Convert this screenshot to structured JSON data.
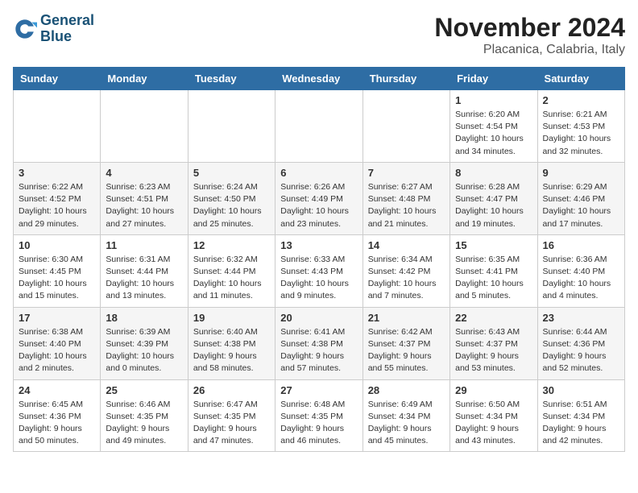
{
  "logo": {
    "line1": "General",
    "line2": "Blue"
  },
  "title": "November 2024",
  "location": "Placanica, Calabria, Italy",
  "headers": [
    "Sunday",
    "Monday",
    "Tuesday",
    "Wednesday",
    "Thursday",
    "Friday",
    "Saturday"
  ],
  "weeks": [
    [
      {
        "day": "",
        "info": ""
      },
      {
        "day": "",
        "info": ""
      },
      {
        "day": "",
        "info": ""
      },
      {
        "day": "",
        "info": ""
      },
      {
        "day": "",
        "info": ""
      },
      {
        "day": "1",
        "info": "Sunrise: 6:20 AM\nSunset: 4:54 PM\nDaylight: 10 hours and 34 minutes."
      },
      {
        "day": "2",
        "info": "Sunrise: 6:21 AM\nSunset: 4:53 PM\nDaylight: 10 hours and 32 minutes."
      }
    ],
    [
      {
        "day": "3",
        "info": "Sunrise: 6:22 AM\nSunset: 4:52 PM\nDaylight: 10 hours and 29 minutes."
      },
      {
        "day": "4",
        "info": "Sunrise: 6:23 AM\nSunset: 4:51 PM\nDaylight: 10 hours and 27 minutes."
      },
      {
        "day": "5",
        "info": "Sunrise: 6:24 AM\nSunset: 4:50 PM\nDaylight: 10 hours and 25 minutes."
      },
      {
        "day": "6",
        "info": "Sunrise: 6:26 AM\nSunset: 4:49 PM\nDaylight: 10 hours and 23 minutes."
      },
      {
        "day": "7",
        "info": "Sunrise: 6:27 AM\nSunset: 4:48 PM\nDaylight: 10 hours and 21 minutes."
      },
      {
        "day": "8",
        "info": "Sunrise: 6:28 AM\nSunset: 4:47 PM\nDaylight: 10 hours and 19 minutes."
      },
      {
        "day": "9",
        "info": "Sunrise: 6:29 AM\nSunset: 4:46 PM\nDaylight: 10 hours and 17 minutes."
      }
    ],
    [
      {
        "day": "10",
        "info": "Sunrise: 6:30 AM\nSunset: 4:45 PM\nDaylight: 10 hours and 15 minutes."
      },
      {
        "day": "11",
        "info": "Sunrise: 6:31 AM\nSunset: 4:44 PM\nDaylight: 10 hours and 13 minutes."
      },
      {
        "day": "12",
        "info": "Sunrise: 6:32 AM\nSunset: 4:44 PM\nDaylight: 10 hours and 11 minutes."
      },
      {
        "day": "13",
        "info": "Sunrise: 6:33 AM\nSunset: 4:43 PM\nDaylight: 10 hours and 9 minutes."
      },
      {
        "day": "14",
        "info": "Sunrise: 6:34 AM\nSunset: 4:42 PM\nDaylight: 10 hours and 7 minutes."
      },
      {
        "day": "15",
        "info": "Sunrise: 6:35 AM\nSunset: 4:41 PM\nDaylight: 10 hours and 5 minutes."
      },
      {
        "day": "16",
        "info": "Sunrise: 6:36 AM\nSunset: 4:40 PM\nDaylight: 10 hours and 4 minutes."
      }
    ],
    [
      {
        "day": "17",
        "info": "Sunrise: 6:38 AM\nSunset: 4:40 PM\nDaylight: 10 hours and 2 minutes."
      },
      {
        "day": "18",
        "info": "Sunrise: 6:39 AM\nSunset: 4:39 PM\nDaylight: 10 hours and 0 minutes."
      },
      {
        "day": "19",
        "info": "Sunrise: 6:40 AM\nSunset: 4:38 PM\nDaylight: 9 hours and 58 minutes."
      },
      {
        "day": "20",
        "info": "Sunrise: 6:41 AM\nSunset: 4:38 PM\nDaylight: 9 hours and 57 minutes."
      },
      {
        "day": "21",
        "info": "Sunrise: 6:42 AM\nSunset: 4:37 PM\nDaylight: 9 hours and 55 minutes."
      },
      {
        "day": "22",
        "info": "Sunrise: 6:43 AM\nSunset: 4:37 PM\nDaylight: 9 hours and 53 minutes."
      },
      {
        "day": "23",
        "info": "Sunrise: 6:44 AM\nSunset: 4:36 PM\nDaylight: 9 hours and 52 minutes."
      }
    ],
    [
      {
        "day": "24",
        "info": "Sunrise: 6:45 AM\nSunset: 4:36 PM\nDaylight: 9 hours and 50 minutes."
      },
      {
        "day": "25",
        "info": "Sunrise: 6:46 AM\nSunset: 4:35 PM\nDaylight: 9 hours and 49 minutes."
      },
      {
        "day": "26",
        "info": "Sunrise: 6:47 AM\nSunset: 4:35 PM\nDaylight: 9 hours and 47 minutes."
      },
      {
        "day": "27",
        "info": "Sunrise: 6:48 AM\nSunset: 4:35 PM\nDaylight: 9 hours and 46 minutes."
      },
      {
        "day": "28",
        "info": "Sunrise: 6:49 AM\nSunset: 4:34 PM\nDaylight: 9 hours and 45 minutes."
      },
      {
        "day": "29",
        "info": "Sunrise: 6:50 AM\nSunset: 4:34 PM\nDaylight: 9 hours and 43 minutes."
      },
      {
        "day": "30",
        "info": "Sunrise: 6:51 AM\nSunset: 4:34 PM\nDaylight: 9 hours and 42 minutes."
      }
    ]
  ]
}
